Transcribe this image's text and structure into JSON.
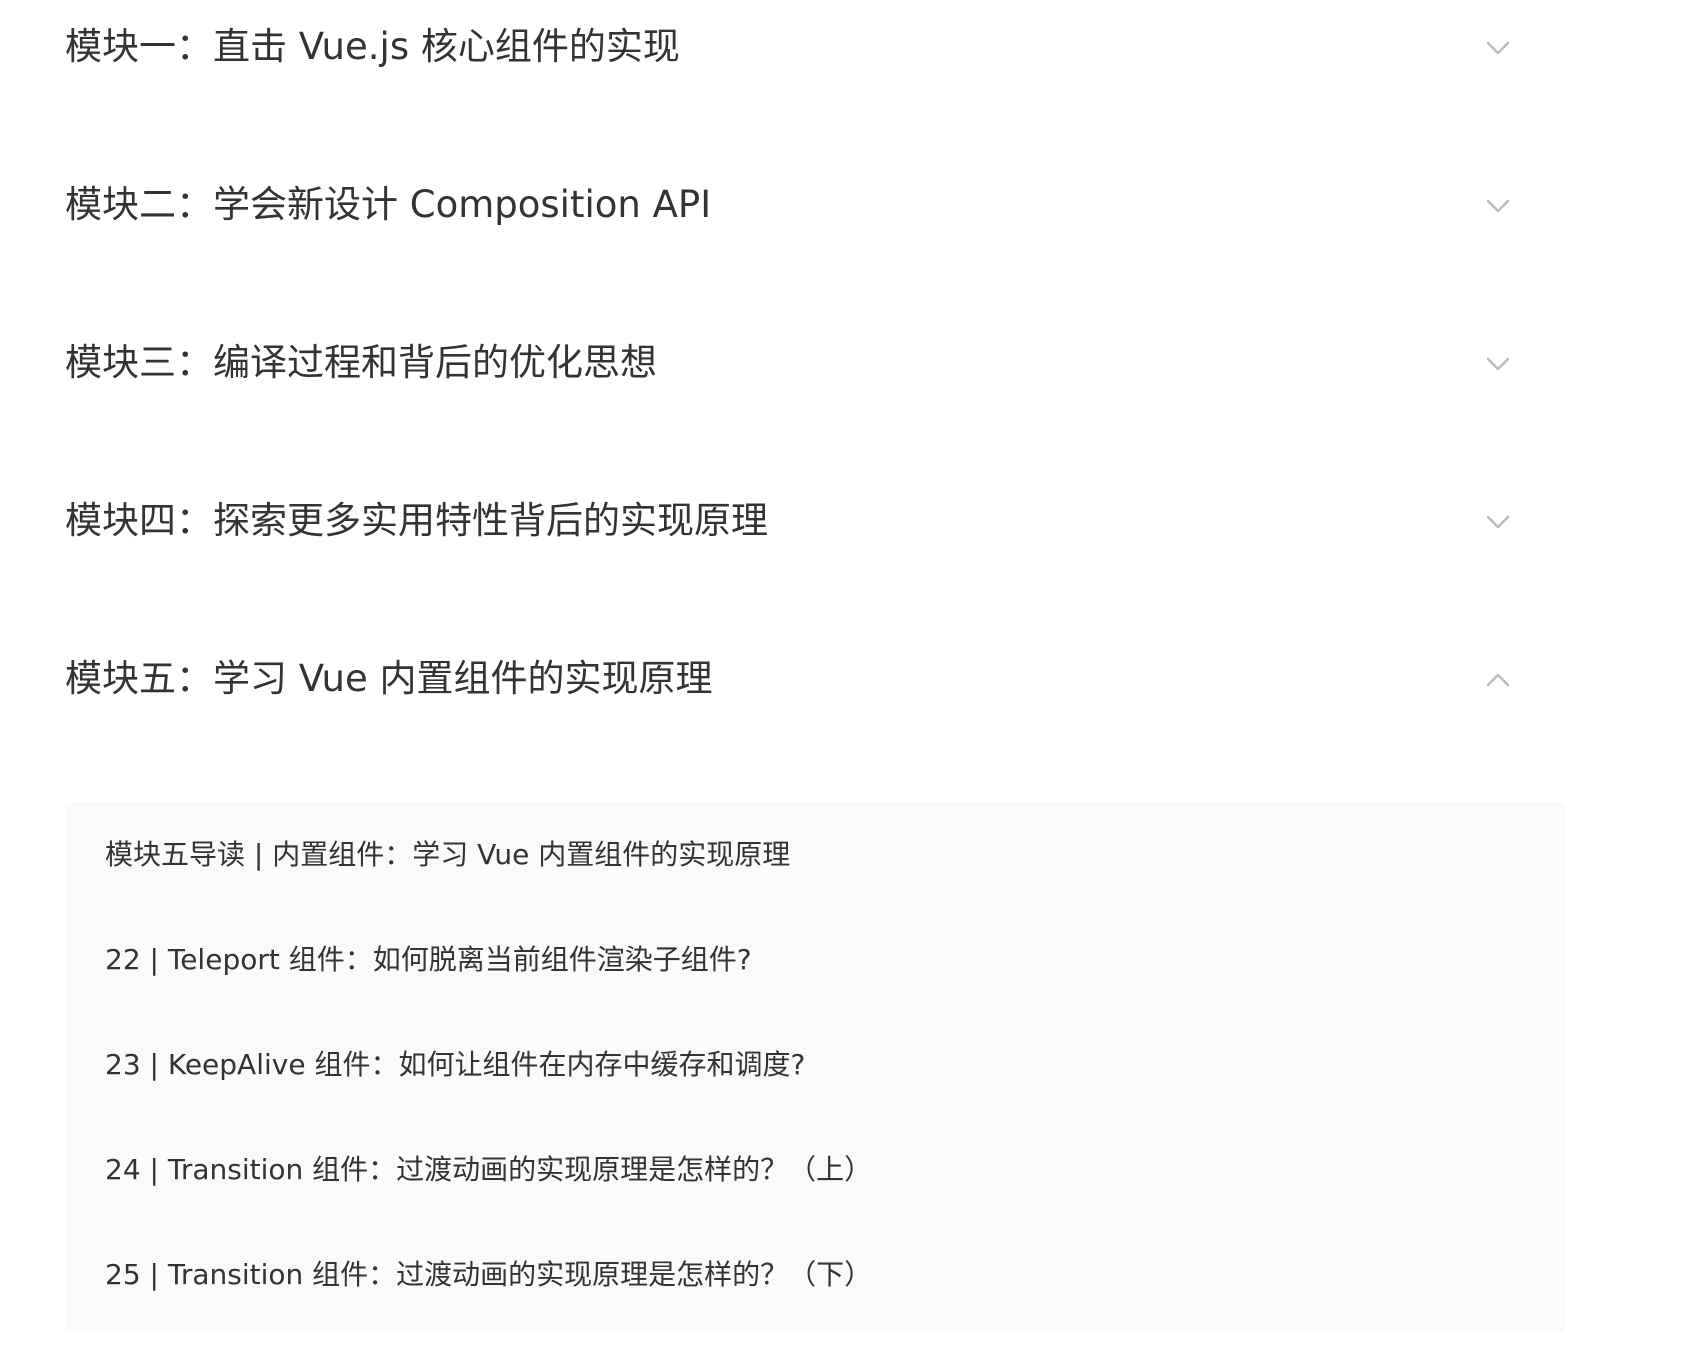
{
  "modules": [
    {
      "title": "模块一：直击 Vue.js 核心组件的实现",
      "expanded": false,
      "icon": "chevron-down-icon"
    },
    {
      "title": "模块二：学会新设计 Composition API",
      "expanded": false,
      "icon": "chevron-down-icon"
    },
    {
      "title": "模块三：编译过程和背后的优化思想",
      "expanded": false,
      "icon": "chevron-down-icon"
    },
    {
      "title": "模块四：探索更多实用特性背后的实现原理",
      "expanded": false,
      "icon": "chevron-down-icon"
    },
    {
      "title": "模块五：学习 Vue 内置组件的实现原理",
      "expanded": true,
      "icon": "chevron-up-icon"
    }
  ],
  "lessons": [
    "模块五导读 | 内置组件：学习 Vue 内置组件的实现原理",
    "22 | Teleport 组件：如何脱离当前组件渲染子组件?",
    "23 | KeepAlive 组件：如何让组件在内存中缓存和调度?",
    "24 | Transition 组件：过渡动画的实现原理是怎样的？（上）",
    "25 | Transition 组件：过渡动画的实现原理是怎样的？（下）"
  ],
  "colors": {
    "text": "#333333",
    "chevron": "#bbbbbb",
    "panel_bg": "#fafafa"
  }
}
